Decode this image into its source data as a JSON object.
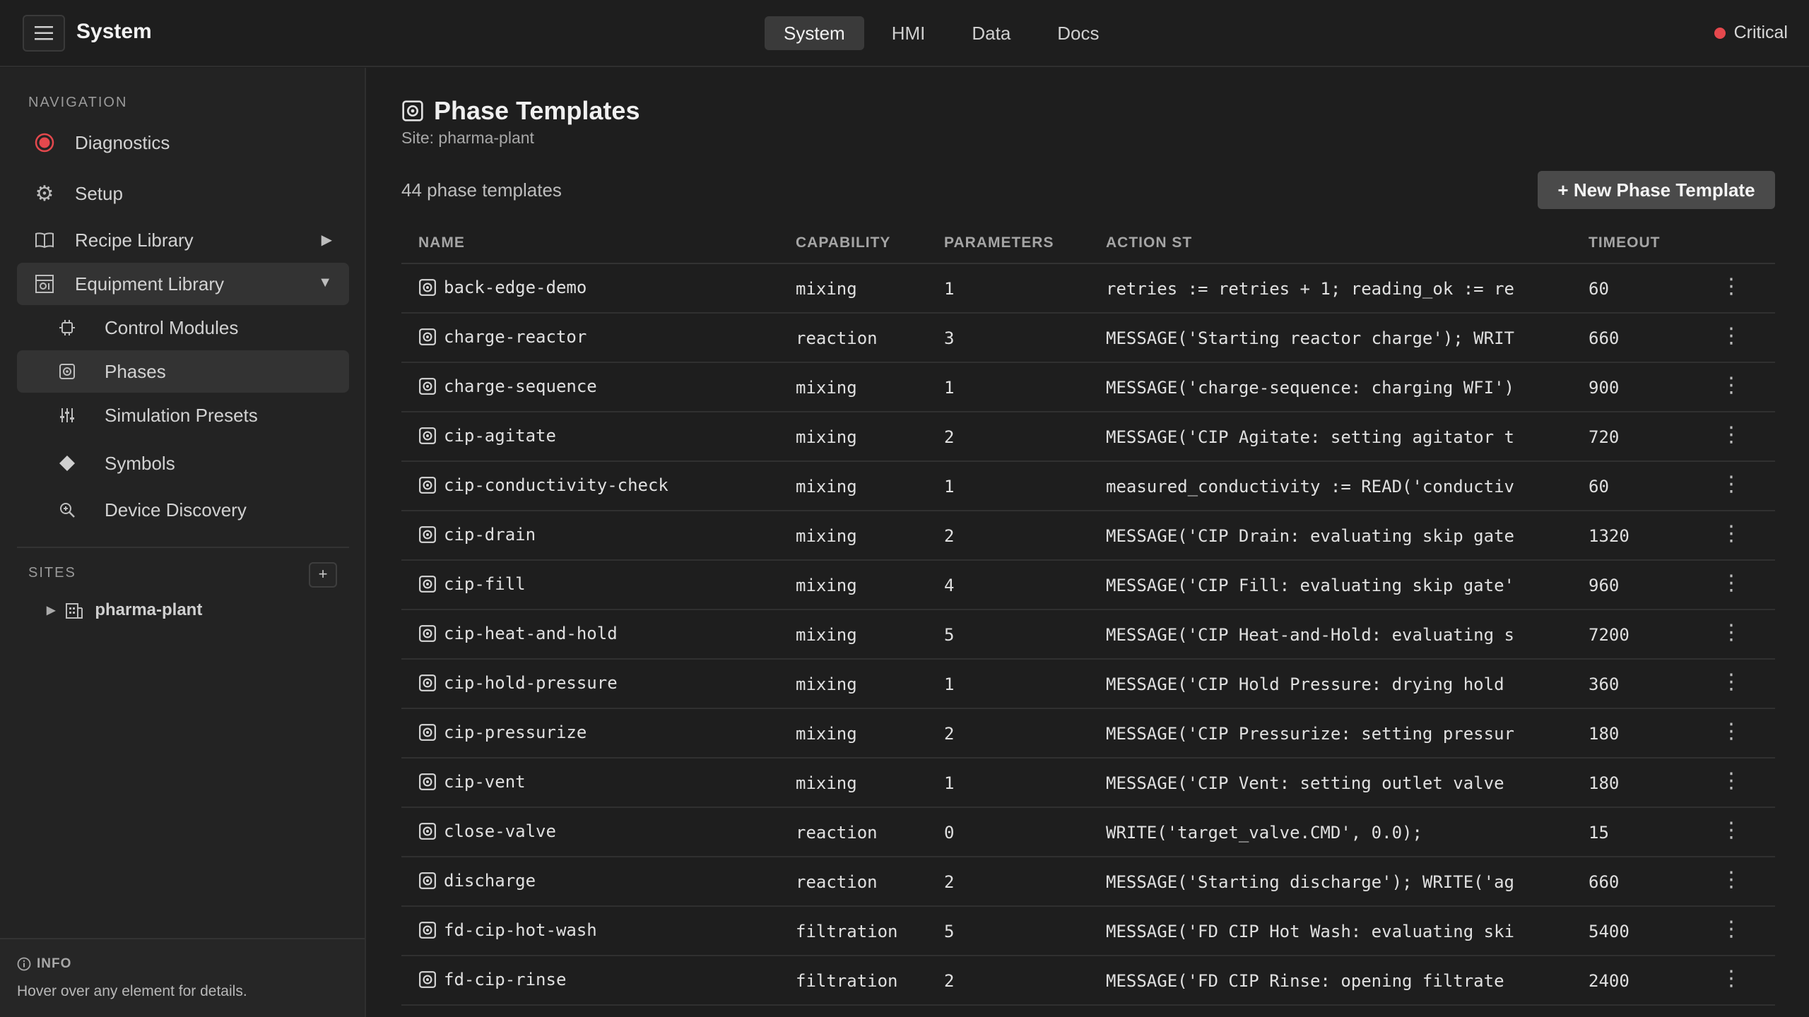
{
  "app": {
    "title": "System",
    "status_label": "Critical",
    "status_color": "#e5484d"
  },
  "tabs": [
    {
      "label": "System",
      "active": true
    },
    {
      "label": "HMI",
      "active": false
    },
    {
      "label": "Data",
      "active": false
    },
    {
      "label": "Docs",
      "active": false
    }
  ],
  "sidebar": {
    "heading": "NAVIGATION",
    "items": [
      {
        "label": "Diagnostics",
        "icon": "diagnostics-record-icon"
      },
      {
        "label": "Setup",
        "icon": "gear-icon"
      },
      {
        "label": "Recipe Library",
        "icon": "book-icon",
        "caret": "▶"
      },
      {
        "label": "Equipment Library",
        "icon": "equipment-library-icon",
        "caret": "▼"
      },
      {
        "label": "Control Modules",
        "icon": "chip-icon"
      },
      {
        "label": "Phases",
        "icon": "phase-icon"
      },
      {
        "label": "Simulation Presets",
        "icon": "sliders-icon"
      },
      {
        "label": "Symbols",
        "icon": "diamond-icon"
      },
      {
        "label": "Device Discovery",
        "icon": "search-zoom-icon"
      }
    ],
    "sites_heading": "SITES",
    "add_site": "+",
    "site": "pharma-plant",
    "info_title": "INFO",
    "info_text": "Hover over any element for details."
  },
  "page": {
    "title": "Phase Templates",
    "subtitle": "Site: pharma-plant",
    "count": "44 phase templates",
    "new_button": "+ New Phase Template"
  },
  "table": {
    "headers": {
      "name": "NAME",
      "capability": "CAPABILITY",
      "parameters": "PARAMETERS",
      "action": "ACTION ST",
      "timeout": "TIMEOUT"
    },
    "rows": [
      {
        "name": "back-edge-demo",
        "capability": "mixing",
        "parameters": "1",
        "action": "retries := retries + 1; reading_ok := re",
        "timeout": "60"
      },
      {
        "name": "charge-reactor",
        "capability": "reaction",
        "parameters": "3",
        "action": "MESSAGE('Starting reactor charge'); WRIT",
        "timeout": "660"
      },
      {
        "name": "charge-sequence",
        "capability": "mixing",
        "parameters": "1",
        "action": "MESSAGE('charge-sequence: charging WFI')",
        "timeout": "900"
      },
      {
        "name": "cip-agitate",
        "capability": "mixing",
        "parameters": "2",
        "action": "MESSAGE('CIP Agitate: setting agitator t",
        "timeout": "720"
      },
      {
        "name": "cip-conductivity-check",
        "capability": "mixing",
        "parameters": "1",
        "action": "measured_conductivity := READ('conductiv",
        "timeout": "60"
      },
      {
        "name": "cip-drain",
        "capability": "mixing",
        "parameters": "2",
        "action": "MESSAGE('CIP Drain: evaluating skip gate",
        "timeout": "1320"
      },
      {
        "name": "cip-fill",
        "capability": "mixing",
        "parameters": "4",
        "action": "MESSAGE('CIP Fill: evaluating skip gate'",
        "timeout": "960"
      },
      {
        "name": "cip-heat-and-hold",
        "capability": "mixing",
        "parameters": "5",
        "action": "MESSAGE('CIP Heat-and-Hold: evaluating s",
        "timeout": "7200"
      },
      {
        "name": "cip-hold-pressure",
        "capability": "mixing",
        "parameters": "1",
        "action": "MESSAGE('CIP Hold Pressure: drying hold",
        "timeout": "360"
      },
      {
        "name": "cip-pressurize",
        "capability": "mixing",
        "parameters": "2",
        "action": "MESSAGE('CIP Pressurize: setting pressur",
        "timeout": "180"
      },
      {
        "name": "cip-vent",
        "capability": "mixing",
        "parameters": "1",
        "action": "MESSAGE('CIP Vent: setting outlet valve",
        "timeout": "180"
      },
      {
        "name": "close-valve",
        "capability": "reaction",
        "parameters": "0",
        "action": "WRITE('target_valve.CMD', 0.0);",
        "timeout": "15"
      },
      {
        "name": "discharge",
        "capability": "reaction",
        "parameters": "2",
        "action": "MESSAGE('Starting discharge'); WRITE('ag",
        "timeout": "660"
      },
      {
        "name": "fd-cip-hot-wash",
        "capability": "filtration",
        "parameters": "5",
        "action": "MESSAGE('FD CIP Hot Wash: evaluating ski",
        "timeout": "5400"
      },
      {
        "name": "fd-cip-rinse",
        "capability": "filtration",
        "parameters": "2",
        "action": "MESSAGE('FD CIP Rinse: opening filtrate",
        "timeout": "2400"
      }
    ]
  }
}
